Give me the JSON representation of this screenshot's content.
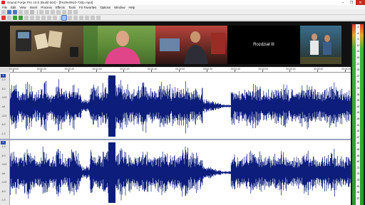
{
  "window": {
    "title": "Sound Forge Pro 10.0 (Build 504) - [fm20e0910-720p.mp4]",
    "controls": [
      "–",
      "❐",
      "✕"
    ]
  },
  "menu": [
    "File",
    "Edit",
    "View",
    "Insert",
    "Process",
    "Effects",
    "Tools",
    "FX Favorites",
    "Options",
    "Window",
    "Help"
  ],
  "toolbar_icons": [
    "new-icon",
    "open-icon",
    "save-icon",
    "save-as-icon",
    "render-icon",
    "close-icon",
    "cut-icon",
    "copy-icon",
    "paste-icon",
    "mix-icon",
    "crop-icon",
    "undo-icon",
    "redo-icon"
  ],
  "transport_icons": [
    "record-icon",
    "loop-icon",
    "play-all-icon",
    "play-icon",
    "pause-icon",
    "stop-icon",
    "go-to-start-icon",
    "rewind-icon",
    "forward-icon",
    "go-to-end-icon",
    "edit-tool-icon",
    "magnify-tool-icon",
    "pencil-tool-icon",
    "envelope-tool-icon",
    "zoom-in-icon",
    "zoom-out-icon",
    "refresh-icon"
  ],
  "video_strip": {
    "frames": [
      {
        "name": "frame-phone-photos",
        "caption": ""
      },
      {
        "name": "frame-man-pink-shirt",
        "caption": ""
      },
      {
        "name": "frame-computer-room",
        "caption": ""
      },
      {
        "name": "frame-title-card",
        "caption": "Rozdział III"
      },
      {
        "name": "frame-people-outdoor",
        "caption": ""
      }
    ]
  },
  "ruler": {
    "labels": [
      "00:00:00",
      "00:00:20",
      "00:00:40",
      "00:01:00",
      "00:01:20",
      "00:01:40",
      "00:02:00",
      "00:02:20",
      "00:02:40",
      "00:03:00",
      "00:03:20",
      "00:03:40",
      "00:04:00"
    ]
  },
  "channels": [
    {
      "number": "1",
      "db_labels": [
        "-1.0",
        "-6.0",
        "-12.0",
        "-Inf.",
        "-12.0",
        "-6.0",
        "-1.0"
      ]
    },
    {
      "number": "2",
      "db_labels": [
        "-1.0",
        "-6.0",
        "-12.0",
        "-Inf.",
        "-12.0",
        "-6.0",
        "-1.0"
      ]
    }
  ],
  "vu_meter": {
    "scale": [
      "-3",
      "-6",
      "-9",
      "-12",
      "-15",
      "-18",
      "-21",
      "-24",
      "-27",
      "-30",
      "-33",
      "-36",
      "-39",
      "-42",
      "-45",
      "-48",
      "-51",
      "-54",
      "-57",
      "-60",
      "-63",
      "-66",
      "-69",
      "-72",
      "-75",
      "-78",
      "-81",
      "-84",
      "-87"
    ]
  },
  "colors": {
    "waveform": "#0c1d7c",
    "wave_bg": "#ffffff",
    "vu_peak": "#e23b2e",
    "vu_level": "#3cb43c",
    "close_button": "#c42b1c"
  }
}
